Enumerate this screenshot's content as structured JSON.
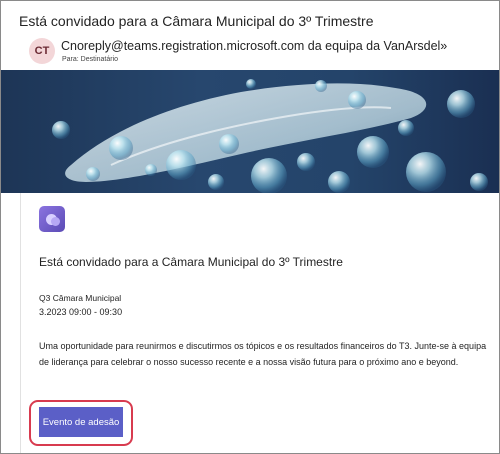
{
  "email": {
    "subject": "Está convidado para a Câmara Municipal do 3º Trimestre",
    "avatar_initials": "CT",
    "sender": "Cnoreply@teams.registration.microsoft.com da equipa da VanArsdel»",
    "recipient": "Para: Destinatário"
  },
  "hero": {
    "image": "teams-event-banner-bubbles"
  },
  "event": {
    "app_icon": "teams-icon",
    "title": "Está convidado para a Câmara Municipal do 3º Trimestre",
    "name": "Q3 Câmara Municipal",
    "time": "3.2023 09:00 - 09:30",
    "description": "Uma oportunidade para reunirmos e discutirmos os tópicos e os resultados financeiros do T3. Junte-se à equipa de liderança para celebrar o nosso sucesso recente e a nossa visão futura para o próximo ano e beyond.",
    "register_label": "Evento de adesão"
  },
  "colors": {
    "accent": "#5b5fc7",
    "highlight": "#d83b4f",
    "avatar_bg": "#f3d6d8",
    "banner": "#24446a"
  }
}
